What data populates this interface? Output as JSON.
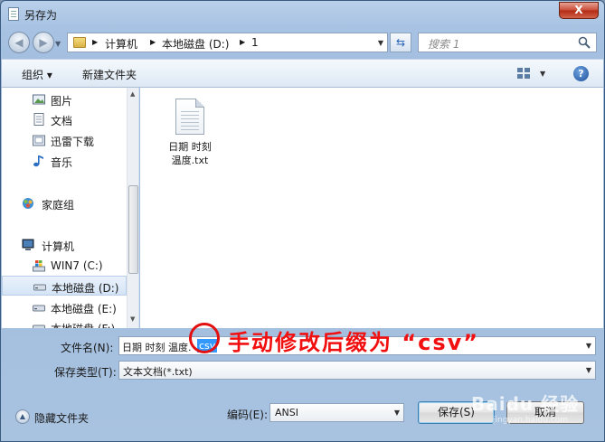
{
  "window": {
    "title": "另存为",
    "close_label": "X"
  },
  "nav": {
    "breadcrumbs": [
      "计算机",
      "本地磁盘 (D:)",
      "1"
    ],
    "search_placeholder": "搜索 1"
  },
  "toolbar": {
    "organize_label": "组织 ▾",
    "new_folder_label": "新建文件夹",
    "help_label": "?"
  },
  "sidebar": {
    "items": [
      {
        "label": "图片",
        "icon": "pictures-icon"
      },
      {
        "label": "文档",
        "icon": "documents-icon"
      },
      {
        "label": "迅雷下载",
        "icon": "download-folder-icon"
      },
      {
        "label": "音乐",
        "icon": "music-icon"
      },
      {
        "label": "家庭组",
        "icon": "homegroup-icon"
      },
      {
        "label": "计算机",
        "icon": "computer-icon"
      },
      {
        "label": "WIN7 (C:)",
        "icon": "windows-drive-icon"
      },
      {
        "label": "本地磁盘 (D:)",
        "icon": "drive-icon",
        "selected": true
      },
      {
        "label": "本地磁盘 (E:)",
        "icon": "drive-icon"
      },
      {
        "label": "本地磁盘 (F:)",
        "icon": "drive-icon"
      }
    ]
  },
  "files": [
    {
      "name_line1": "日期 时刻",
      "name_line2": "温度.txt",
      "icon": "text-file-icon"
    }
  ],
  "form": {
    "filename_label": "文件名(N):",
    "filename_value": "日期 时刻 温度.",
    "filename_selected": "csv",
    "type_label": "保存类型(T):",
    "type_value": "文本文档(*.txt)",
    "encoding_label": "编码(E):",
    "encoding_value": "ANSI",
    "save_label": "保存(S)",
    "cancel_label": "取消"
  },
  "footer": {
    "hide_folders_label": "隐藏文件夹"
  },
  "annotation": {
    "text": "手动修改后缀为 “csv”",
    "color": "#f10f0f"
  },
  "watermark": {
    "text": "Baidu 经验",
    "sub": "jingyan.baidu.com"
  }
}
